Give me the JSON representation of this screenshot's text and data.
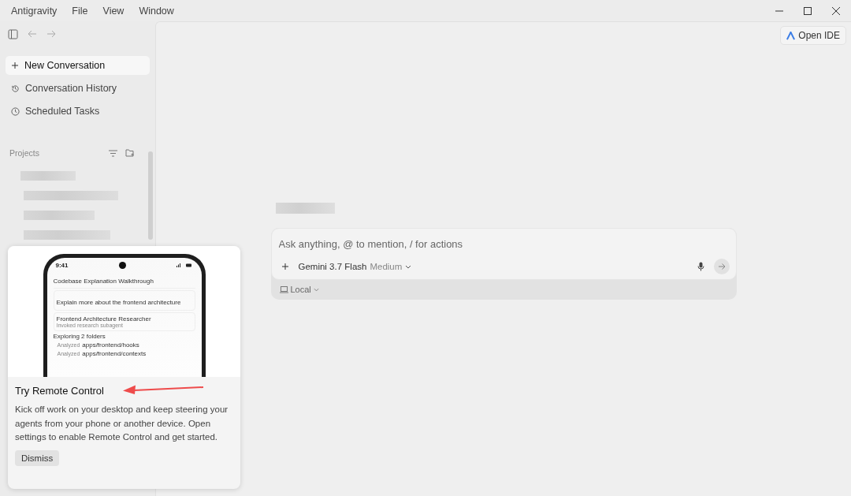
{
  "menu": [
    "Antigravity",
    "File",
    "View",
    "Window"
  ],
  "sidebar": {
    "items": [
      {
        "label": "New Conversation",
        "selected": true
      },
      {
        "label": "Conversation History",
        "selected": false
      },
      {
        "label": "Scheduled Tasks",
        "selected": false
      }
    ],
    "projects_label": "Projects"
  },
  "header": {
    "open_ide": "Open IDE"
  },
  "composer": {
    "placeholder": "Ask anything, @ to mention, / for actions",
    "model": "Gemini 3.7 Flash",
    "effort": "Medium",
    "location": "Local"
  },
  "promo": {
    "phone": {
      "time": "9:41",
      "title": "Codebase Explanation Walkthrough",
      "prompt": "Explain more about the frontend architecture",
      "agent": "Frontend Architecture Researcher",
      "agent_sub": "Invoked research subagent",
      "exploring": "Exploring 2 folders",
      "folders": [
        {
          "label": "Analyzed",
          "path": "apps/frontend/hooks"
        },
        {
          "label": "Analyzed",
          "path": "apps/frontend/contexts"
        }
      ]
    },
    "title": "Try Remote Control",
    "body": "Kick off work on your desktop and keep steering your agents from your phone or another device. Open settings to enable Remote Control and get started.",
    "dismiss": "Dismiss"
  }
}
